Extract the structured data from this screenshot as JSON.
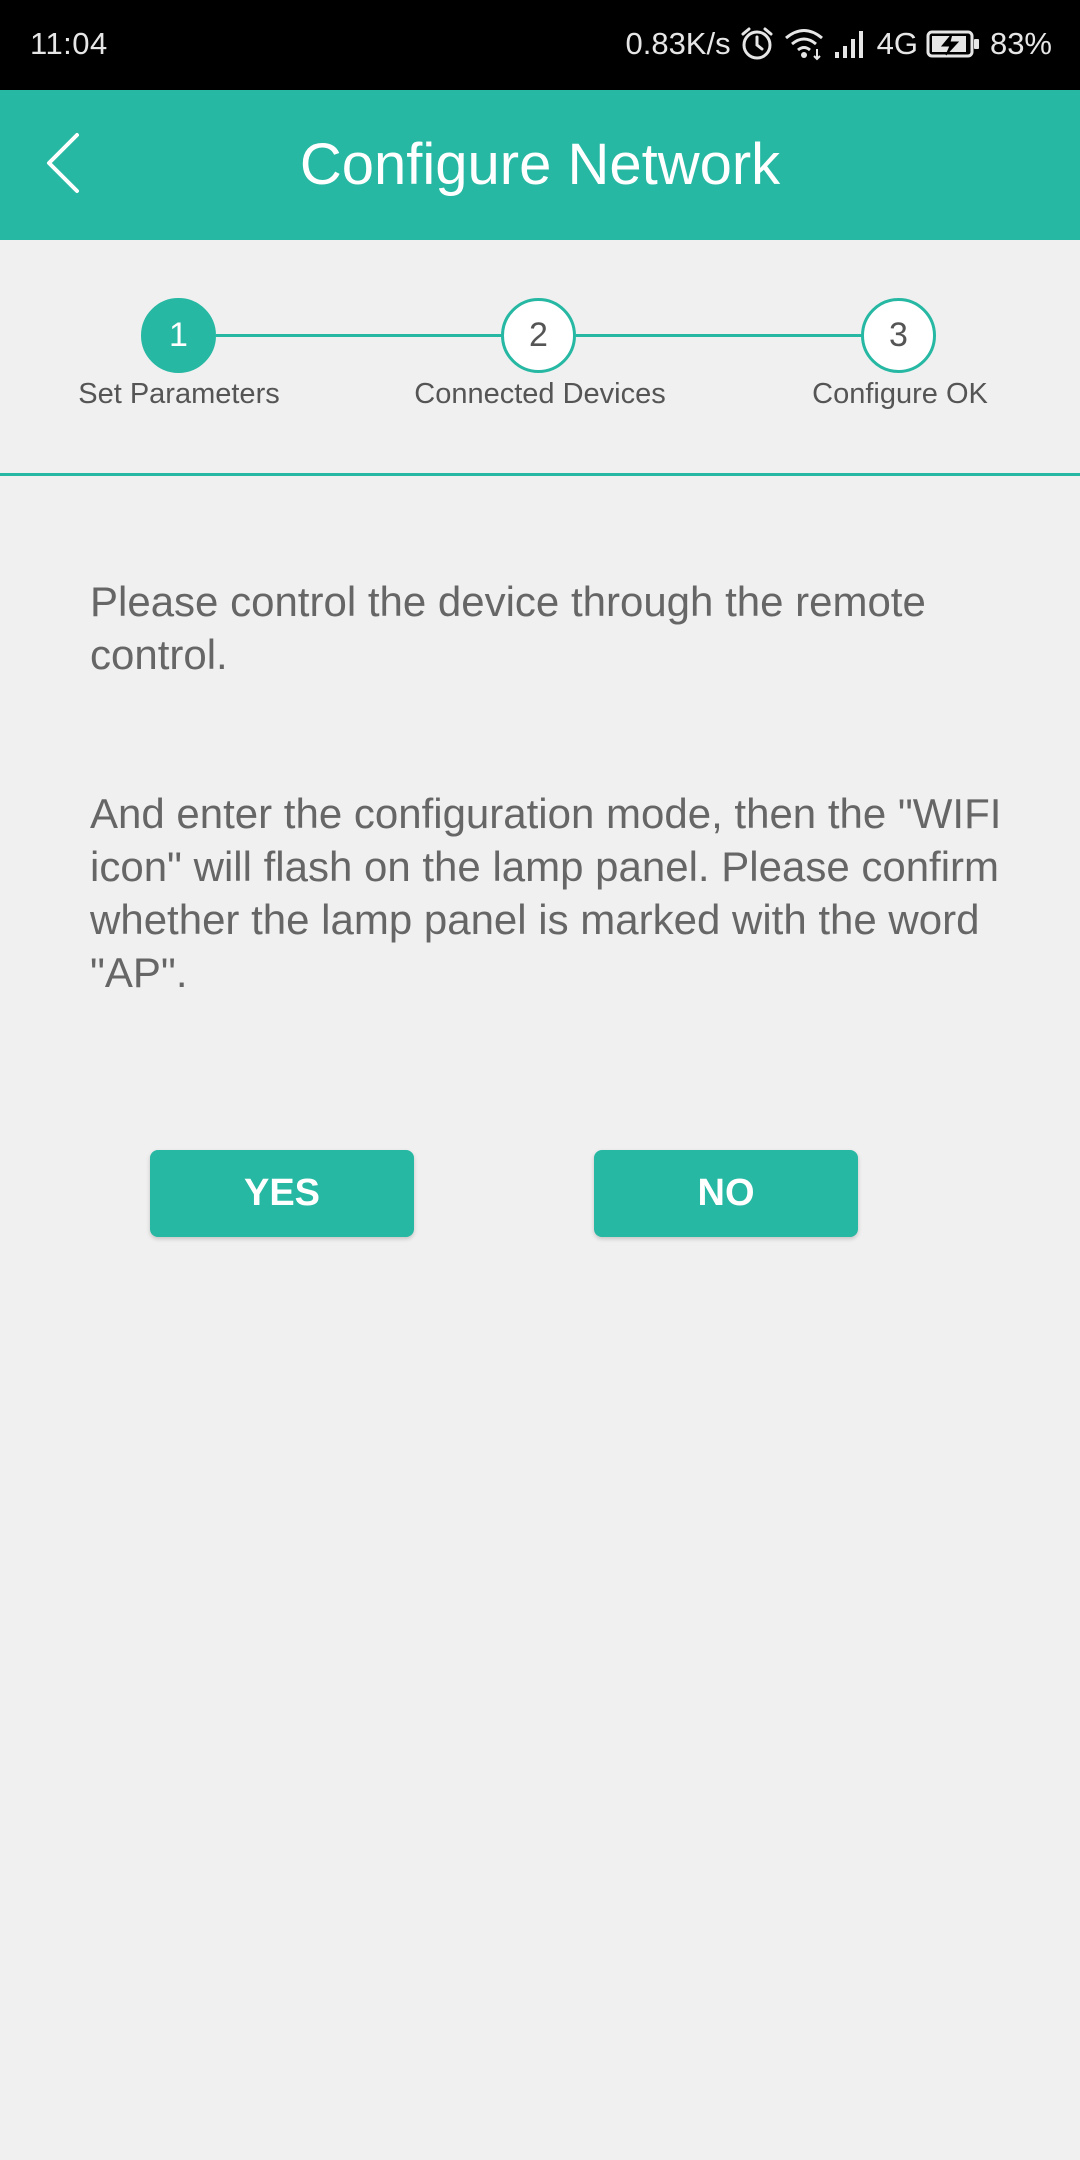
{
  "status_bar": {
    "time": "11:04",
    "network_speed": "0.83K/s",
    "network_type": "4G",
    "battery": "83%",
    "icons": [
      "alarm-icon",
      "wifi-icon",
      "signal-icon",
      "battery-charging-icon"
    ]
  },
  "header": {
    "title": "Configure Network",
    "back_icon": "chevron-left-icon"
  },
  "stepper": {
    "current_step": 1,
    "steps": [
      {
        "number": "1",
        "label": "Set Parameters"
      },
      {
        "number": "2",
        "label": "Connected Devices"
      },
      {
        "number": "3",
        "label": "Configure OK"
      }
    ]
  },
  "content": {
    "instruction_1": "Please control the device through the remote control.",
    "instruction_2": "And enter the configuration mode, then the \"WIFI icon\" will flash on the lamp panel. Please confirm whether the lamp panel is marked with the word \"AP\"."
  },
  "buttons": {
    "yes_label": "YES",
    "no_label": "NO"
  },
  "colors": {
    "accent": "#26b8a3",
    "background": "#f0f0f0",
    "status_bar": "#000000",
    "text": "#666666"
  }
}
